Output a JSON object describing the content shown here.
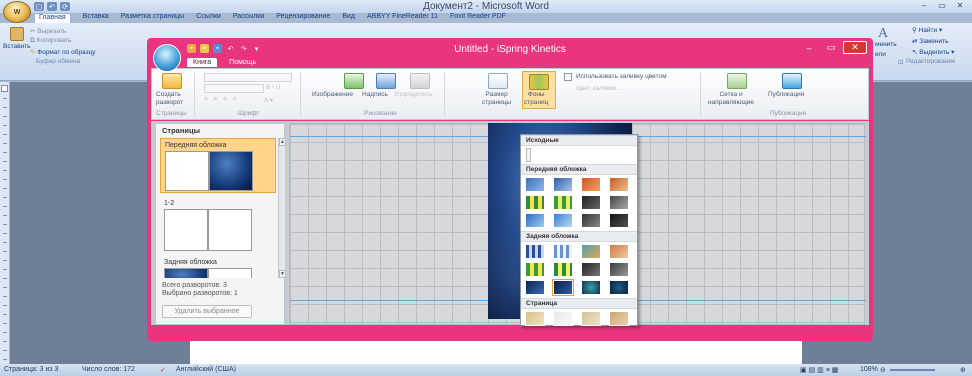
{
  "word": {
    "title": "Документ2 - Microsoft Word",
    "orb_label": "W",
    "qat": [
      "▢",
      "↶",
      "⟳"
    ],
    "controls": [
      "–",
      "▭",
      "✕"
    ],
    "tabs": [
      "Главная",
      "Вставка",
      "Разметка страницы",
      "Ссылки",
      "Рассылки",
      "Рецензирование",
      "Вид",
      "ABBYY FineReader 11",
      "Foxit Reader PDF"
    ],
    "active_tab": "Главная",
    "ribbon": {
      "paste": "Вставить",
      "cut": "Вырезать",
      "copy": "Копировать",
      "format_painter": "Формат по образцу",
      "clipboard_group": "Буфер обмена",
      "replace_partial": "менить",
      "select_partial": "ели",
      "find": "Найти",
      "replace": "Заменить",
      "select": "Выделить",
      "editing_group": "Редактирование"
    },
    "status": {
      "page": "Страница: 3 из 3",
      "words": "Число слов: 172",
      "language": "Английский (США)",
      "zoom": "108%"
    }
  },
  "ispring": {
    "title": "Untitled - iSpring Kinetics",
    "controls": [
      "–",
      "▭",
      "✕"
    ],
    "tabs": [
      "Книга",
      "Помощь"
    ],
    "active_tab": "Книга",
    "ribbon": {
      "create_spread": "Создать\nразворот",
      "pages_group": "Страницы",
      "font_group": "Шрифт",
      "image": "Изображение",
      "caption": "Надпись",
      "arrange": "Упорядочить",
      "drawing_group": "Рисование",
      "page_size": "Размер\nстраницы",
      "page_bg": "Фоны\nстраниц",
      "use_color_fill": "Использовать заливку цветом",
      "fill_color": "Цвет заливки...",
      "grid_guides": "Сетка и\nнаправляющие",
      "publish": "Публикация",
      "publish_group": "Публикация"
    },
    "pages_panel": {
      "header": "Страницы",
      "items": [
        {
          "label": "Передняя обложка",
          "selected": true
        },
        {
          "label": "1-2",
          "selected": false
        },
        {
          "label": "Задняя обложка",
          "selected": false
        }
      ],
      "total_spreads": "Всего разворотов: 3",
      "selected_spreads": "Выбрано разворотов: 1",
      "delete_button": "Удалить выбранное"
    },
    "dropdown": {
      "sections": [
        "Исходные",
        "Передняя обложка",
        "Задняя обложка",
        "Страница"
      ]
    }
  },
  "colors": {
    "accent_frame": "#e8357d",
    "word_blue": "#15428b",
    "selected_page": "#ffd58a"
  }
}
